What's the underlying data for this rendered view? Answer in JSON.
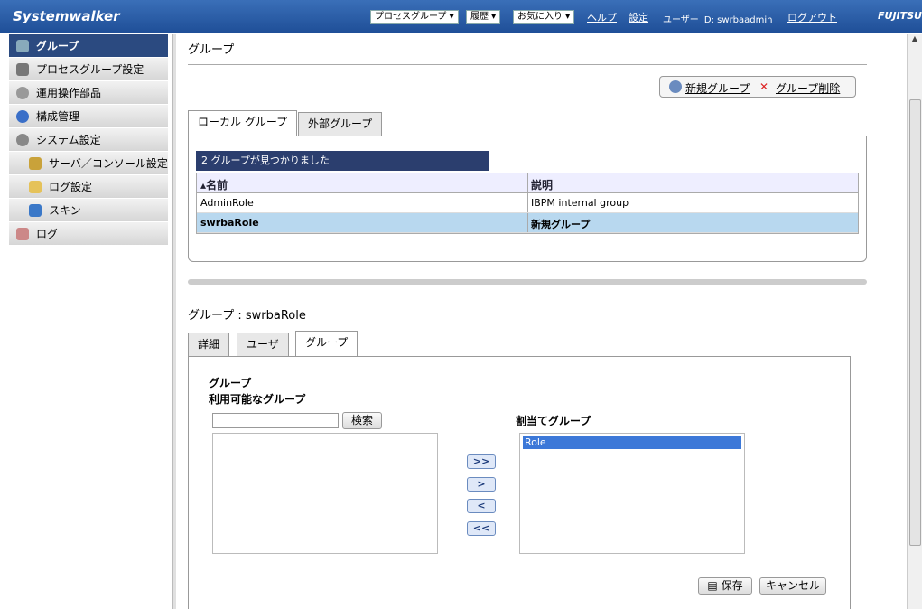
{
  "app": {
    "logo": "Systemwalker",
    "brand": "FUJITSU"
  },
  "topnav": {
    "process_group": "プロセスグループ ▾",
    "history": "履歴 ▾",
    "favorites": "お気に入り ▾",
    "help": "ヘルプ",
    "settings": "設定",
    "user": "ユーザー ID: swrbaadmin",
    "logout": "ログアウト"
  },
  "sidebar": {
    "items": [
      {
        "label": "グループ"
      },
      {
        "label": "プロセスグループ設定"
      },
      {
        "label": "運用操作部品"
      },
      {
        "label": "構成管理"
      },
      {
        "label": "システム設定"
      },
      {
        "label": "サーバ／コンソール設定"
      },
      {
        "label": "ログ設定"
      },
      {
        "label": "スキン"
      },
      {
        "label": "ログ"
      }
    ]
  },
  "main": {
    "title": "グループ",
    "actions": {
      "new_group": "新規グループ",
      "delete_group": "グループ削除"
    },
    "tabs": [
      "ローカル グループ",
      "外部グループ"
    ],
    "found": "2 グループが見つかりました",
    "columns": [
      "▴名前",
      "説明"
    ],
    "rows": [
      [
        "AdminRole",
        "IBPM internal group"
      ],
      [
        "swrbaRole",
        "新規グループ"
      ]
    ],
    "detail": {
      "title": "グループ : swrbaRole",
      "tabs": [
        "詳細",
        "ユーザ",
        "グループ"
      ],
      "section": "グループ",
      "available_label": "利用可能なグループ",
      "search_button": "検索",
      "assigned_label": "割当てグループ",
      "assigned_items": [
        "Role"
      ],
      "move_all_right": ">>",
      "move_right": ">",
      "move_left": "<",
      "move_all_left": "<<",
      "save": "保存",
      "cancel": "キャンセル"
    }
  }
}
